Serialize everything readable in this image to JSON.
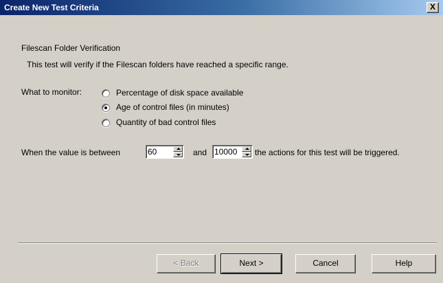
{
  "window": {
    "title": "Create New Test Criteria",
    "close_symbol": "X"
  },
  "test": {
    "name": "Filescan Folder Verification",
    "description": "This test will verify if the Filescan folders have reached a specific range."
  },
  "monitor": {
    "label": "What to monitor:",
    "options": [
      {
        "label": "Percentage of disk space available",
        "selected": false
      },
      {
        "label": "Age of control files (in minutes)",
        "selected": true
      },
      {
        "label": "Quantity of bad control files",
        "selected": false
      }
    ]
  },
  "range": {
    "prefix": "When the value is between",
    "low_value": "60",
    "middle": "and",
    "high_value": "10000",
    "suffix": "the actions for this test will be triggered."
  },
  "buttons": {
    "back": "< Back",
    "next": "Next >",
    "cancel": "Cancel",
    "help": "Help"
  }
}
